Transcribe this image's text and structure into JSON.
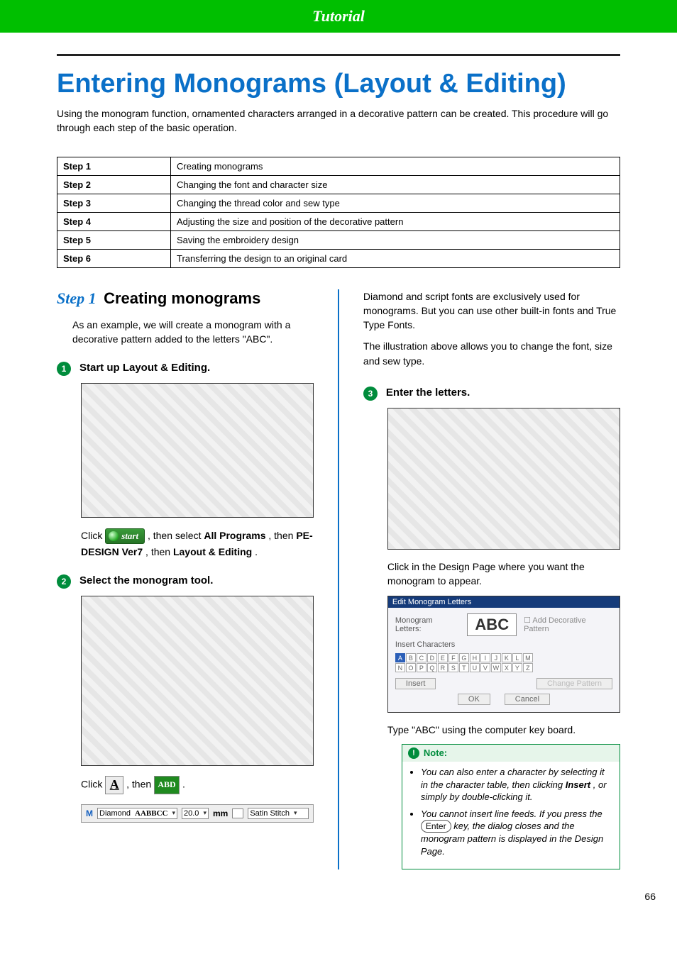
{
  "header": {
    "title": "Tutorial"
  },
  "page_title": "Entering Monograms (Layout & Editing)",
  "intro": "Using the monogram function, ornamented characters arranged in a decorative pattern can be created. This procedure will go through each step of the basic operation.",
  "steps_table": [
    {
      "step": "Step 1",
      "desc": "Creating monograms"
    },
    {
      "step": "Step 2",
      "desc": "Changing the font and character size"
    },
    {
      "step": "Step 3",
      "desc": "Changing the thread color and sew type"
    },
    {
      "step": "Step 4",
      "desc": "Adjusting the size and position of the decorative pattern"
    },
    {
      "step": "Step 5",
      "desc": "Saving the embroidery design"
    },
    {
      "step": "Step 6",
      "desc": "Transferring the design to an original card"
    }
  ],
  "step1": {
    "label": "Step 1",
    "title": "Creating monograms",
    "example": "As an example, we will create a monogram with a decorative pattern added to the letters \"ABC\".",
    "sub1": {
      "num": "1",
      "title": "Start up Layout & Editing.",
      "click_prefix": "Click ",
      "start_label": "start",
      "click_middle": ", then select ",
      "all_programs": "All Programs",
      "then1": ", then ",
      "pedesign": "PE-DESIGN Ver7",
      "then2": ", then ",
      "layout": "Layout & Editing",
      "period": "."
    },
    "sub2": {
      "num": "2",
      "title": "Select the monogram tool.",
      "click": "Click ",
      "then": ", then ",
      "a_icon": "A",
      "abd_icon": "ABD",
      "period": ".",
      "font_bar": {
        "m_icon": "M",
        "font_name": "Diamond",
        "font_sample": "AABBCC",
        "size": "20.0",
        "unit": "mm",
        "stitch": "Satin Stitch"
      }
    },
    "right_intro1": "Diamond and script fonts are exclusively used for monograms. But you can use other built-in fonts and True Type Fonts.",
    "right_intro2": "The illustration above allows you to change the font, size and sew type.",
    "sub3": {
      "num": "3",
      "title": "Enter the letters.",
      "click_text": "Click in the Design Page where you want the monogram to appear.",
      "dialog": {
        "title": "Edit Monogram Letters",
        "label": "Monogram Letters:",
        "value": "ABC",
        "checkbox": "Add Decorative Pattern",
        "insert_chars": "Insert Characters",
        "keys_row1": [
          "A",
          "B",
          "C",
          "D",
          "E",
          "F",
          "G",
          "H",
          "I",
          "J",
          "K",
          "L",
          "M"
        ],
        "keys_row2": [
          "N",
          "O",
          "P",
          "Q",
          "R",
          "S",
          "T",
          "U",
          "V",
          "W",
          "X",
          "Y",
          "Z"
        ],
        "insert_btn": "Insert",
        "change_btn": "Change Pattern",
        "ok": "OK",
        "cancel": "Cancel"
      },
      "type_text": "Type \"ABC\" using the computer key board.",
      "note": {
        "title": "Note:",
        "item1_a": "You can also enter a character by selecting it in the character table, then clicking ",
        "item1_b": "Insert",
        "item1_c": ", or simply by double-clicking it.",
        "item2_a": "You cannot insert line feeds. If you press the ",
        "item2_key": "Enter",
        "item2_b": " key, the dialog closes and the monogram pattern is displayed in the Design Page."
      }
    }
  },
  "page_number": "66"
}
